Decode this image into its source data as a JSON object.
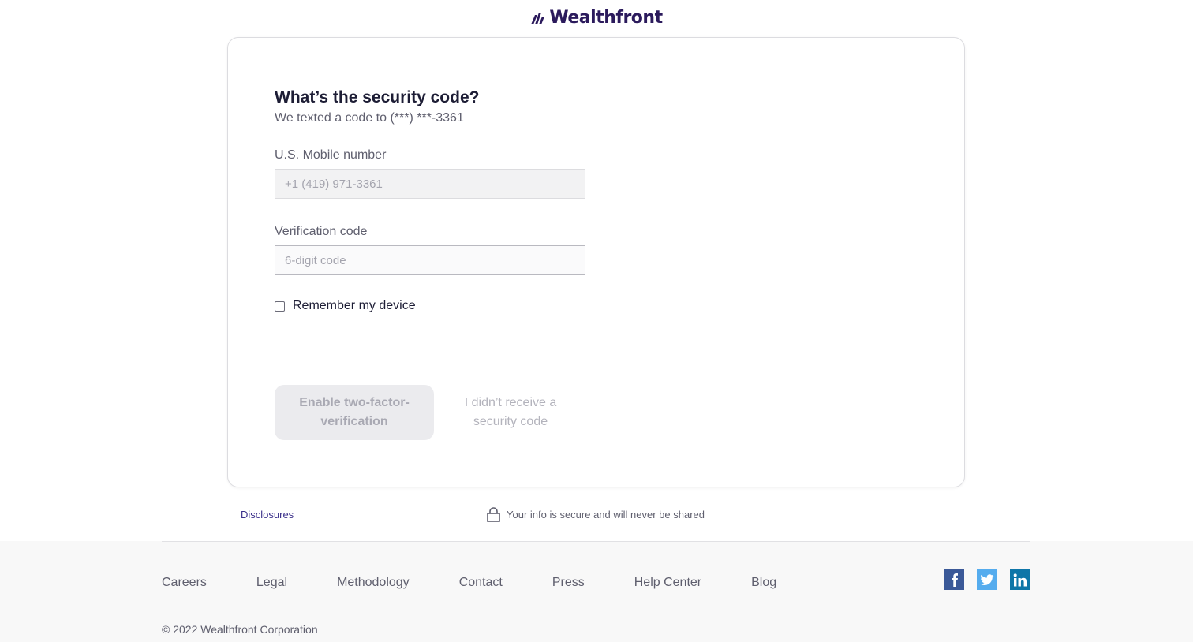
{
  "brand": {
    "name": "Wealthfront",
    "color": "#2b1a5c"
  },
  "form": {
    "heading": "What’s the security code?",
    "subheading": "We texted a code to (***) ***-3361",
    "phone_label": "U.S. Mobile number",
    "phone_placeholder": "+1 (419) 971-3361",
    "code_label": "Verification code",
    "code_placeholder": "6-digit code",
    "remember_label": "Remember my device",
    "remember_checked": false,
    "submit_label": "Enable two-factor-verification",
    "resend_label": "I didn’t receive a security code"
  },
  "below_card": {
    "disclosures": "Disclosures",
    "secure_text": "Your info is secure and will never be shared"
  },
  "footer": {
    "links": [
      "Careers",
      "Legal",
      "Methodology",
      "Contact",
      "Press",
      "Help Center",
      "Blog"
    ],
    "social": [
      "facebook-icon",
      "twitter-icon",
      "linkedin-icon"
    ],
    "copyright": "© 2022 Wealthfront Corporation"
  }
}
